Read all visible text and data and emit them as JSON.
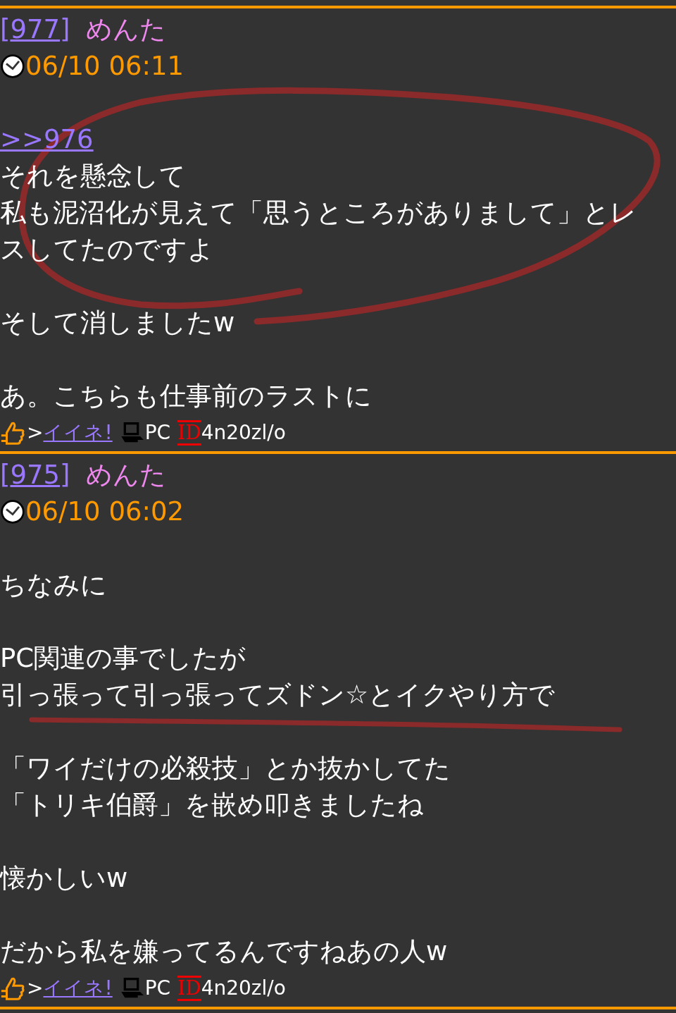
{
  "posts": [
    {
      "open": "[",
      "number": "977",
      "close": "]",
      "name": "めんた",
      "date": "06/10 06:11",
      "blocks": [
        [
          {
            "kind": "link",
            "text": ">>976"
          },
          {
            "kind": "text",
            "text": "それを懸念して"
          },
          {
            "kind": "text",
            "text": "私も泥沼化が見えて「思うところがありまして」とレ"
          },
          {
            "kind": "text",
            "text": "スしてたのですよ"
          }
        ],
        [
          {
            "kind": "text",
            "text": "そして消しましたw"
          }
        ],
        [
          {
            "kind": "text",
            "text": "あ。こちらも仕事前のラストに"
          }
        ]
      ],
      "footer": {
        "arrow": ">",
        "like": "イイネ!",
        "device": "PC",
        "id_label": "ID",
        "id": "4n20zl/o"
      }
    },
    {
      "open": "[",
      "number": "975",
      "close": "]",
      "name": "めんた",
      "date": "06/10 06:02",
      "blocks": [
        [
          {
            "kind": "text",
            "text": "ちなみに"
          }
        ],
        [
          {
            "kind": "text",
            "text": "PC関連の事でしたが"
          },
          {
            "kind": "text",
            "text": "引っ張って引っ張ってズドン☆とイクやり方で"
          }
        ],
        [
          {
            "kind": "text",
            "text": "「ワイだけの必殺技」とか抜かしてた"
          },
          {
            "kind": "text",
            "text": "「トリキ伯爵」を嵌め叩きましたね"
          }
        ],
        [
          {
            "kind": "text",
            "text": "懐かしいw"
          }
        ],
        [
          {
            "kind": "text",
            "text": "だから私を嫌ってるんですねあの人w"
          }
        ]
      ],
      "footer": {
        "arrow": ">",
        "like": "イイネ!",
        "device": "PC",
        "id_label": "ID",
        "id": "4n20zl/o"
      }
    }
  ]
}
